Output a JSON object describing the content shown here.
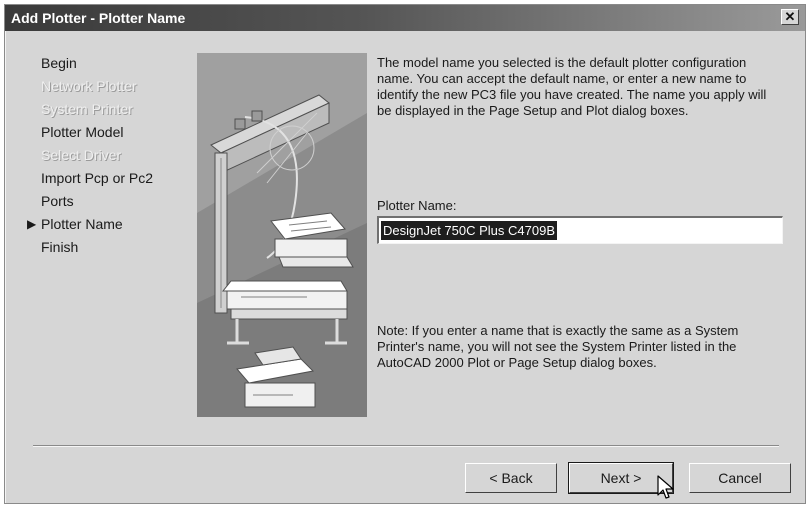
{
  "window": {
    "title": "Add Plotter - Plotter Name",
    "close_glyph": "✕"
  },
  "steps": [
    {
      "label": "Begin",
      "state": "enabled"
    },
    {
      "label": "Network Plotter",
      "state": "disabled"
    },
    {
      "label": "System Printer",
      "state": "disabled"
    },
    {
      "label": "Plotter Model",
      "state": "enabled"
    },
    {
      "label": "Select Driver",
      "state": "disabled"
    },
    {
      "label": "Import Pcp or Pc2",
      "state": "enabled"
    },
    {
      "label": "Ports",
      "state": "enabled"
    },
    {
      "label": "Plotter Name",
      "state": "current"
    },
    {
      "label": "Finish",
      "state": "enabled"
    }
  ],
  "current_step_glyph": "▶",
  "content": {
    "description": "The model name you selected is the default plotter configuration name. You can accept the default name, or enter a new name to identify the new PC3 file you have created. The name you apply will be displayed in the Page Setup and Plot dialog boxes.",
    "plotter_name_label": "Plotter Name:",
    "plotter_name_value": "DesignJet 750C Plus C4709B",
    "note": "Note: If you enter a name that is exactly the same as a System Printer's name, you will not see the System Printer listed in the AutoCAD 2000 Plot or Page Setup dialog boxes."
  },
  "buttons": {
    "back": "< Back",
    "next": "Next >",
    "cancel": "Cancel"
  },
  "icons": {
    "close": "close-icon",
    "current_step": "triangle-right-icon",
    "cursor": "mouse-pointer-icon"
  },
  "colors": {
    "titlebar_start": "#3a3a3a",
    "titlebar_end": "#9a9a9a",
    "dialog_bg": "#d6d6d6",
    "selection_bg": "#1e1e1e"
  }
}
